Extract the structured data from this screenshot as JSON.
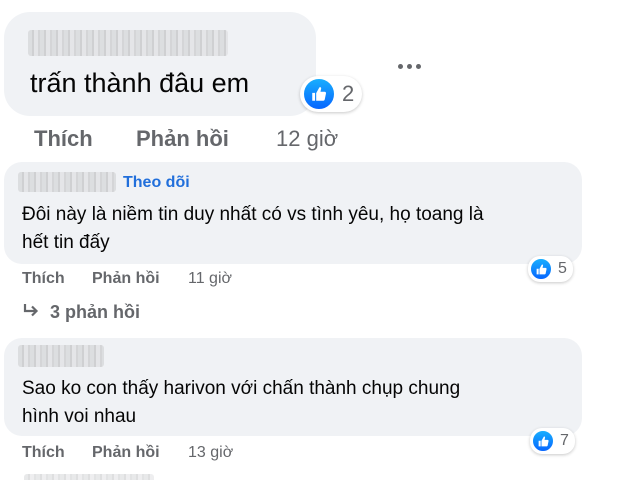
{
  "comments": [
    {
      "text": "trấn thành đâu em",
      "like_label": "Thích",
      "reply_label": "Phản hồi",
      "time": "12 giờ",
      "reaction_count": "2",
      "reaction_icon": "like-icon"
    },
    {
      "follow_label": "Theo dõi",
      "text_line1": "Đôi này là niềm tin duy nhất có vs tình yêu, họ toang là",
      "text_line2": "hết tin đấy",
      "like_label": "Thích",
      "reply_label": "Phản hồi",
      "time": "11 giờ",
      "reaction_count": "5",
      "reaction_icon": "like-icon",
      "replies_label": "3 phản hồi"
    },
    {
      "text_line1": "Sao ko con thấy harivon với chấn thành chụp chung",
      "text_line2": "hình voi nhau",
      "like_label": "Thích",
      "reply_label": "Phản hồi",
      "time": "13 giờ",
      "reaction_count": "7",
      "reaction_icon": "like-icon"
    }
  ],
  "colors": {
    "bubble": "#f0f2f5",
    "link_blue": "#216fdb",
    "muted": "#65676b",
    "like_blue": "#0766ff"
  }
}
